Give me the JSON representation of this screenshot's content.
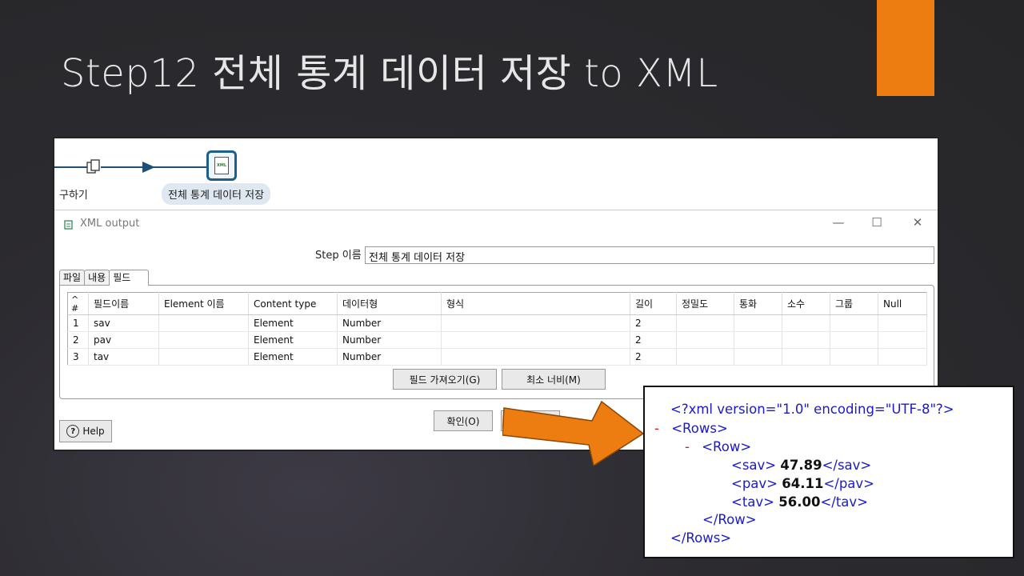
{
  "slide": {
    "title": "Step12 전체 통계 데이터 저장 to XML",
    "accent_color": "#ed7d10"
  },
  "canvas": {
    "prev_step_label": "구하기",
    "xml_step_label": "전체 통계 데이터 저장",
    "xml_icon_text": "XML",
    "icons": [
      "step-copy-icon",
      "xml-output-step-icon"
    ]
  },
  "dialog": {
    "title": "XML output",
    "controls": {
      "minimize": "—",
      "maximize": "☐",
      "close": "✕"
    },
    "step_name_label": "Step 이름",
    "step_name_value": "전체 통계 데이터 저장",
    "tabs": [
      {
        "label": "파일",
        "active": false
      },
      {
        "label": "내용",
        "active": false
      },
      {
        "label": "필드",
        "active": true
      }
    ],
    "grid": {
      "sort_indicator": "^",
      "row_header": "#",
      "columns": [
        "필드이름",
        "Element 이름",
        "Content type",
        "데이터형",
        "형식",
        "길이",
        "정밀도",
        "통화",
        "소수",
        "그룹",
        "Null"
      ],
      "rows": [
        {
          "num": "1",
          "field": "sav",
          "element": "",
          "content_type": "Element",
          "type": "Number",
          "format": "",
          "length": "2",
          "precision": "",
          "currency": "",
          "decimal": "",
          "group": "",
          "null": ""
        },
        {
          "num": "2",
          "field": "pav",
          "element": "",
          "content_type": "Element",
          "type": "Number",
          "format": "",
          "length": "2",
          "precision": "",
          "currency": "",
          "decimal": "",
          "group": "",
          "null": ""
        },
        {
          "num": "3",
          "field": "tav",
          "element": "",
          "content_type": "Element",
          "type": "Number",
          "format": "",
          "length": "2",
          "precision": "",
          "currency": "",
          "decimal": "",
          "group": "",
          "null": ""
        }
      ]
    },
    "buttons": {
      "get_fields": "필드 가져오기(G)",
      "min_width": "최소 너비(M)",
      "ok": "확인(O)",
      "help": "Help"
    }
  },
  "xml_preview": {
    "declaration": "<?xml version=\"1.0\" encoding=\"UTF-8\"?>",
    "collapse_marker": "-",
    "rows_open": "<Rows>",
    "row_open": "<Row>",
    "fields": [
      {
        "open": "<sav>",
        "value": "47.89",
        "close": "</sav>"
      },
      {
        "open": "<pav>",
        "value": "64.11",
        "close": "</pav>"
      },
      {
        "open": "<tav>",
        "value": "56.00",
        "close": "</tav>"
      }
    ],
    "row_close": "</Row>",
    "rows_close": "</Rows>"
  },
  "callout_arrow_color": "#ed7d10"
}
